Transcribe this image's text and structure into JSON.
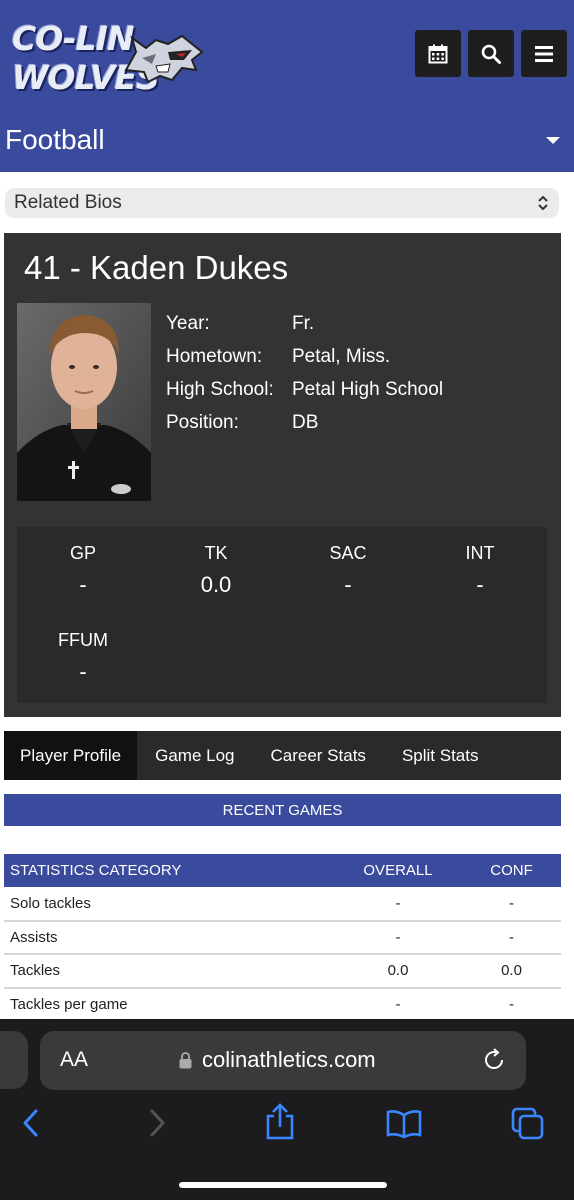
{
  "header": {
    "logo_left": "CO-LIN",
    "logo_right": "WOLVES",
    "buttons": [
      "calendar-icon",
      "search-icon",
      "menu-icon"
    ],
    "sport": "Football",
    "brand_color": "#3a4a9c"
  },
  "bios_select": {
    "label": "Related Bios"
  },
  "player": {
    "name": "41 - Kaden Dukes",
    "info": [
      {
        "label": "Year:",
        "value": "Fr."
      },
      {
        "label": "Hometown:",
        "value": "Petal, Miss."
      },
      {
        "label": "High School:",
        "value": "Petal High School"
      },
      {
        "label": "Position:",
        "value": "DB"
      }
    ],
    "stats": [
      {
        "label": "GP",
        "value": "-"
      },
      {
        "label": "TK",
        "value": "0.0"
      },
      {
        "label": "SAC",
        "value": "-"
      },
      {
        "label": "INT",
        "value": "-"
      },
      {
        "label": "FFUM",
        "value": "-"
      }
    ]
  },
  "tabs": [
    "Player Profile",
    "Game Log",
    "Career Stats",
    "Split Stats"
  ],
  "recent_games": "RECENT GAMES",
  "table": {
    "headers": [
      "STATISTICS CATEGORY",
      "OVERALL",
      "CONF"
    ],
    "rows": [
      [
        "Solo tackles",
        "-",
        "-"
      ],
      [
        "Assists",
        "-",
        "-"
      ],
      [
        "Tackles",
        "0.0",
        "0.0"
      ],
      [
        "Tackles per game",
        "-",
        "-"
      ]
    ]
  },
  "browser": {
    "text_size": "AA",
    "url": "colinathletics.com"
  }
}
